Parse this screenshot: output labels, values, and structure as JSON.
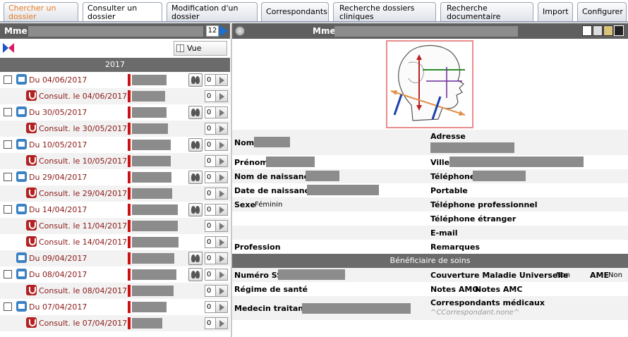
{
  "tabs": [
    {
      "label": "Chercher un dossier",
      "state": "orange"
    },
    {
      "label": "Consulter un dossier",
      "state": "active"
    },
    {
      "label": "Modification d'un dossier",
      "state": ""
    },
    {
      "label": "Correspondants",
      "state": ""
    },
    {
      "label": "Recherche dossiers cliniques",
      "state": ""
    },
    {
      "label": "Recherche documentaire",
      "state": ""
    },
    {
      "label": "Import",
      "state": ""
    },
    {
      "label": "Configurer",
      "state": ""
    }
  ],
  "left": {
    "title": "Mme",
    "count": "12",
    "vue_globale": "Vue globale",
    "year": "2017",
    "rows": [
      {
        "type": "main",
        "label": "Du 04/06/2017",
        "lungs": true,
        "count": "0"
      },
      {
        "type": "sub",
        "label": "Consult. le 04/06/2017",
        "count": "0"
      },
      {
        "type": "main",
        "label": "Du 30/05/2017",
        "lungs": true,
        "count": "0"
      },
      {
        "type": "sub",
        "label": "Consult. le 30/05/2017",
        "count": "0"
      },
      {
        "type": "main",
        "label": "Du 10/05/2017",
        "lungs": true,
        "count": "0"
      },
      {
        "type": "sub",
        "label": "Consult. le 10/05/2017",
        "count": "0"
      },
      {
        "type": "main",
        "label": "Du 29/04/2017",
        "lungs": true,
        "count": "0"
      },
      {
        "type": "sub",
        "label": "Consult. le 29/04/2017",
        "count": "0"
      },
      {
        "type": "main",
        "label": "Du 14/04/2017",
        "lungs": true,
        "count": "0"
      },
      {
        "type": "sub",
        "label": "Consult. le 11/04/2017",
        "count": "0"
      },
      {
        "type": "sub",
        "label": "Consult. le 14/04/2017",
        "count": "0"
      },
      {
        "type": "main-nochk",
        "label": "Du 09/04/2017",
        "lungs": true,
        "count": "0"
      },
      {
        "type": "main",
        "label": "Du 08/04/2017",
        "lungs": true,
        "count": "0"
      },
      {
        "type": "sub",
        "label": "Consult. le 08/04/2017",
        "count": "0"
      },
      {
        "type": "main",
        "label": "Du 07/04/2017",
        "lungs": false,
        "count": "0"
      },
      {
        "type": "sub",
        "label": "Consult. le 07/04/2017",
        "count": "0"
      }
    ]
  },
  "right": {
    "title": "Mme",
    "fields": {
      "nom": "Nom",
      "adresse": "Adresse",
      "prenom": "Prénom",
      "ville": "Ville",
      "nom_naissance": "Nom de naissance",
      "telephone": "Téléphone",
      "date_naissance": "Date de naissance",
      "portable": "Portable",
      "sexe": "Sexe",
      "sexe_value": "Féminin",
      "tel_pro": "Téléphone professionnel",
      "tel_etranger": "Téléphone étranger",
      "email": "E-mail",
      "profession": "Profession",
      "remarques": "Remarques"
    },
    "beneficiaire": {
      "section": "Bénéficiaire de soins",
      "numero_ss": "Numéro SS",
      "cmu": "Couverture Maladie Universelle",
      "cmu_value": "Non",
      "ame": "AME",
      "ame_value": "Non",
      "regime": "Régime de santé",
      "notes_amo": "Notes AMO",
      "notes_amc": "Notes AMC",
      "medecin": "Medecin traitant",
      "correspondants": "Correspondants médicaux",
      "correspondants_value": "^CCorrespondant.none^"
    }
  }
}
